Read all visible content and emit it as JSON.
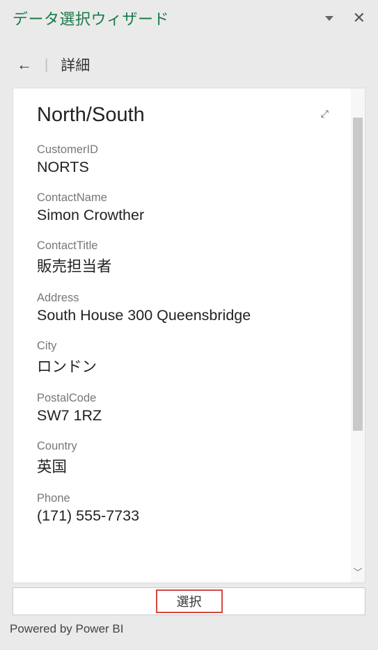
{
  "header": {
    "title": "データ選択ウィザード"
  },
  "nav": {
    "breadcrumb": "詳細"
  },
  "record": {
    "heading": "North/South",
    "fields": [
      {
        "label": "CustomerID",
        "value": "NORTS"
      },
      {
        "label": "ContactName",
        "value": "Simon Crowther"
      },
      {
        "label": "ContactTitle",
        "value": "販売担当者"
      },
      {
        "label": "Address",
        "value": "South House 300 Queensbridge"
      },
      {
        "label": "City",
        "value": "ロンドン"
      },
      {
        "label": "PostalCode",
        "value": "SW7 1RZ"
      },
      {
        "label": "Country",
        "value": "英国"
      },
      {
        "label": "Phone",
        "value": "(171) 555-7733"
      }
    ]
  },
  "actions": {
    "select_label": "選択"
  },
  "footer": {
    "text": "Powered by Power BI"
  }
}
